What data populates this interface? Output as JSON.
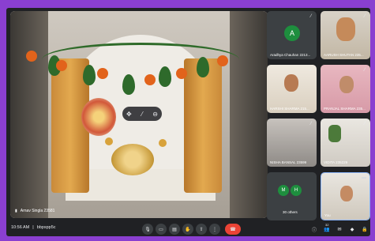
{
  "main_tile": {
    "presenter_name": "Arnav Singla 23581"
  },
  "tiles": [
    {
      "name": "Aradhya Chauhan 2213...",
      "avatar_letter": "A",
      "avatar_color": "#1e8e3e"
    },
    {
      "name": "AARUSH SHUTAN 235...",
      "avatar_letter": "",
      "avatar_color": ""
    },
    {
      "name": "HARSHI SHARMA 215...",
      "avatar_letter": "",
      "avatar_color": ""
    },
    {
      "name": "PRANJAL SHARMA 235...",
      "avatar_letter": "",
      "avatar_color": ""
    },
    {
      "name": "NISHA BANSAL 23599",
      "avatar_letter": "",
      "avatar_color": ""
    },
    {
      "name": "VIDITA 235229",
      "avatar_letter": "",
      "avatar_color": ""
    },
    {
      "name": "30 others",
      "avatar_letter_1": "M",
      "avatar_letter_2": "H",
      "avatar_color": "#1e8e3e"
    },
    {
      "name": "You",
      "avatar_letter": "",
      "avatar_color": ""
    }
  ],
  "meeting": {
    "time": "10:56 AM",
    "code": "bbpspp5c"
  },
  "controls": {
    "mic_icon": "mic-icon",
    "camera_icon": "camera-icon",
    "captions_icon": "captions-icon",
    "raise_hand_icon": "raise-hand-icon",
    "present_icon": "present-icon",
    "more_icon": "more-options-icon",
    "end_call_icon": "end-call-icon"
  },
  "right_controls": {
    "participants_count": "32"
  },
  "colors": {
    "end_call": "#ea4335",
    "frame": "#8a3fd0",
    "background": "#202124"
  }
}
